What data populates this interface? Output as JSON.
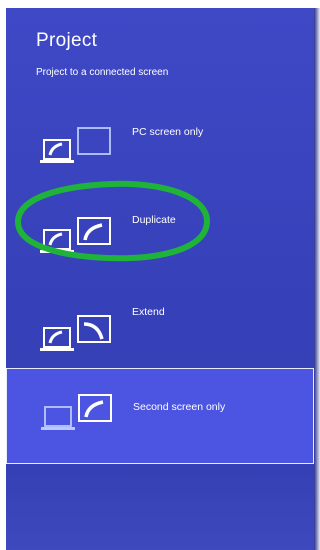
{
  "app": {
    "title": "Project",
    "subtitle": "Project to a connected screen"
  },
  "options": [
    {
      "label": "PC screen only",
      "icon": "pc-screen-only-icon",
      "selected": false
    },
    {
      "label": "Duplicate",
      "icon": "duplicate-icon",
      "selected": false
    },
    {
      "label": "Extend",
      "icon": "extend-icon",
      "selected": false
    },
    {
      "label": "Second screen only",
      "icon": "second-screen-only-icon",
      "selected": true
    }
  ],
  "annotation": {
    "shape": "hand-drawn oval",
    "color": "#1fb33a",
    "encircles": "Duplicate"
  },
  "colors": {
    "background": "#3a44bf",
    "selected": "#4c55e2",
    "text": "#ffffff"
  }
}
